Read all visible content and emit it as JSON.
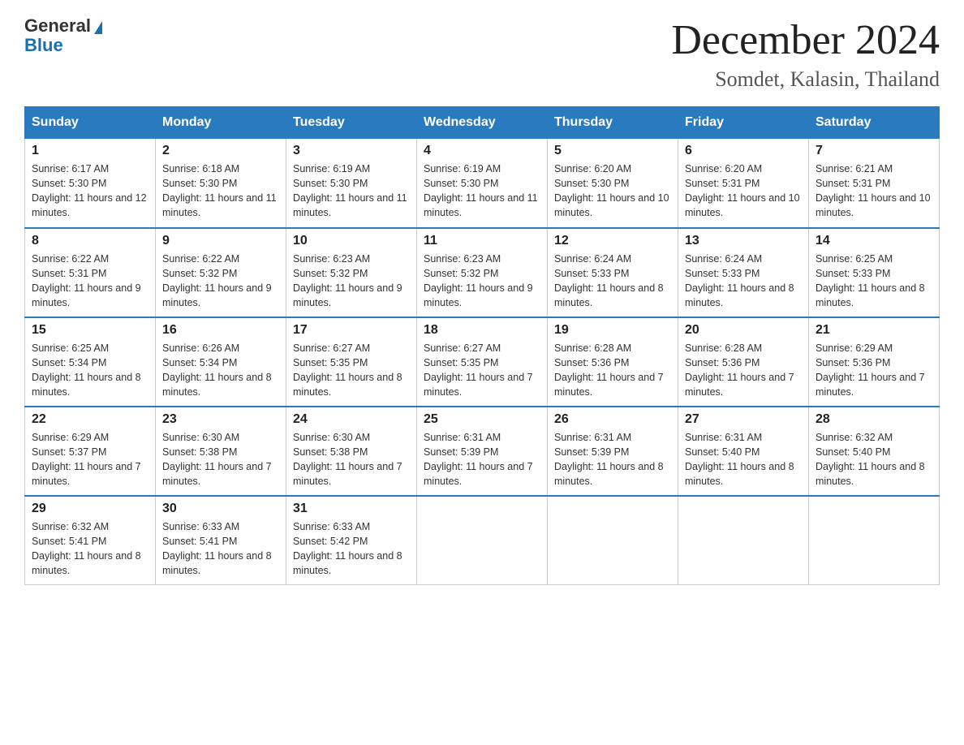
{
  "logo": {
    "general": "General",
    "blue": "Blue"
  },
  "header": {
    "month": "December 2024",
    "location": "Somdet, Kalasin, Thailand"
  },
  "days_of_week": [
    "Sunday",
    "Monday",
    "Tuesday",
    "Wednesday",
    "Thursday",
    "Friday",
    "Saturday"
  ],
  "weeks": [
    [
      {
        "day": "1",
        "sunrise": "6:17 AM",
        "sunset": "5:30 PM",
        "daylight": "11 hours and 12 minutes."
      },
      {
        "day": "2",
        "sunrise": "6:18 AM",
        "sunset": "5:30 PM",
        "daylight": "11 hours and 11 minutes."
      },
      {
        "day": "3",
        "sunrise": "6:19 AM",
        "sunset": "5:30 PM",
        "daylight": "11 hours and 11 minutes."
      },
      {
        "day": "4",
        "sunrise": "6:19 AM",
        "sunset": "5:30 PM",
        "daylight": "11 hours and 11 minutes."
      },
      {
        "day": "5",
        "sunrise": "6:20 AM",
        "sunset": "5:30 PM",
        "daylight": "11 hours and 10 minutes."
      },
      {
        "day": "6",
        "sunrise": "6:20 AM",
        "sunset": "5:31 PM",
        "daylight": "11 hours and 10 minutes."
      },
      {
        "day": "7",
        "sunrise": "6:21 AM",
        "sunset": "5:31 PM",
        "daylight": "11 hours and 10 minutes."
      }
    ],
    [
      {
        "day": "8",
        "sunrise": "6:22 AM",
        "sunset": "5:31 PM",
        "daylight": "11 hours and 9 minutes."
      },
      {
        "day": "9",
        "sunrise": "6:22 AM",
        "sunset": "5:32 PM",
        "daylight": "11 hours and 9 minutes."
      },
      {
        "day": "10",
        "sunrise": "6:23 AM",
        "sunset": "5:32 PM",
        "daylight": "11 hours and 9 minutes."
      },
      {
        "day": "11",
        "sunrise": "6:23 AM",
        "sunset": "5:32 PM",
        "daylight": "11 hours and 9 minutes."
      },
      {
        "day": "12",
        "sunrise": "6:24 AM",
        "sunset": "5:33 PM",
        "daylight": "11 hours and 8 minutes."
      },
      {
        "day": "13",
        "sunrise": "6:24 AM",
        "sunset": "5:33 PM",
        "daylight": "11 hours and 8 minutes."
      },
      {
        "day": "14",
        "sunrise": "6:25 AM",
        "sunset": "5:33 PM",
        "daylight": "11 hours and 8 minutes."
      }
    ],
    [
      {
        "day": "15",
        "sunrise": "6:25 AM",
        "sunset": "5:34 PM",
        "daylight": "11 hours and 8 minutes."
      },
      {
        "day": "16",
        "sunrise": "6:26 AM",
        "sunset": "5:34 PM",
        "daylight": "11 hours and 8 minutes."
      },
      {
        "day": "17",
        "sunrise": "6:27 AM",
        "sunset": "5:35 PM",
        "daylight": "11 hours and 8 minutes."
      },
      {
        "day": "18",
        "sunrise": "6:27 AM",
        "sunset": "5:35 PM",
        "daylight": "11 hours and 7 minutes."
      },
      {
        "day": "19",
        "sunrise": "6:28 AM",
        "sunset": "5:36 PM",
        "daylight": "11 hours and 7 minutes."
      },
      {
        "day": "20",
        "sunrise": "6:28 AM",
        "sunset": "5:36 PM",
        "daylight": "11 hours and 7 minutes."
      },
      {
        "day": "21",
        "sunrise": "6:29 AM",
        "sunset": "5:36 PM",
        "daylight": "11 hours and 7 minutes."
      }
    ],
    [
      {
        "day": "22",
        "sunrise": "6:29 AM",
        "sunset": "5:37 PM",
        "daylight": "11 hours and 7 minutes."
      },
      {
        "day": "23",
        "sunrise": "6:30 AM",
        "sunset": "5:38 PM",
        "daylight": "11 hours and 7 minutes."
      },
      {
        "day": "24",
        "sunrise": "6:30 AM",
        "sunset": "5:38 PM",
        "daylight": "11 hours and 7 minutes."
      },
      {
        "day": "25",
        "sunrise": "6:31 AM",
        "sunset": "5:39 PM",
        "daylight": "11 hours and 7 minutes."
      },
      {
        "day": "26",
        "sunrise": "6:31 AM",
        "sunset": "5:39 PM",
        "daylight": "11 hours and 8 minutes."
      },
      {
        "day": "27",
        "sunrise": "6:31 AM",
        "sunset": "5:40 PM",
        "daylight": "11 hours and 8 minutes."
      },
      {
        "day": "28",
        "sunrise": "6:32 AM",
        "sunset": "5:40 PM",
        "daylight": "11 hours and 8 minutes."
      }
    ],
    [
      {
        "day": "29",
        "sunrise": "6:32 AM",
        "sunset": "5:41 PM",
        "daylight": "11 hours and 8 minutes."
      },
      {
        "day": "30",
        "sunrise": "6:33 AM",
        "sunset": "5:41 PM",
        "daylight": "11 hours and 8 minutes."
      },
      {
        "day": "31",
        "sunrise": "6:33 AM",
        "sunset": "5:42 PM",
        "daylight": "11 hours and 8 minutes."
      },
      null,
      null,
      null,
      null
    ]
  ]
}
